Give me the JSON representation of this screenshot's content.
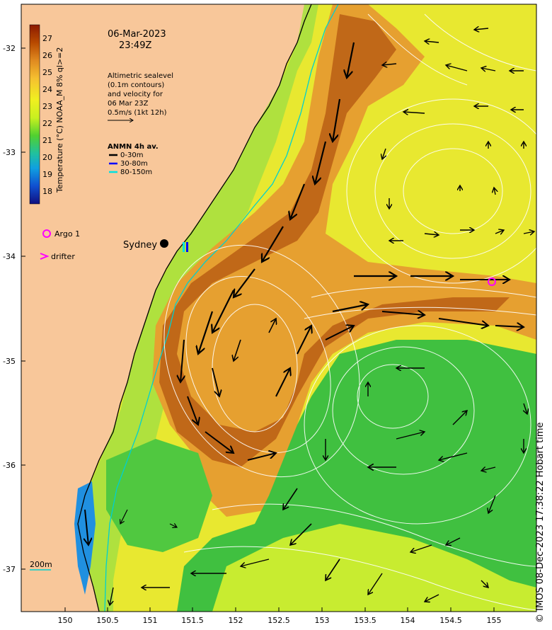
{
  "map": {
    "date": "06-Mar-2023",
    "time": "23:49Z",
    "info_lines": [
      "Altimetric sealevel",
      "(0.1m contours)",
      "and velocity for",
      "06 Mar 23Z",
      "0.5m/s (1kt 12h)"
    ],
    "colorbar": {
      "label": "Temperature (°C) NOAA_M 8% ql>=2",
      "ticks": [
        "27",
        "26",
        "25",
        "24",
        "23",
        "22",
        "21",
        "20",
        "19",
        "18"
      ],
      "colors": [
        "#8b1a00",
        "#b84a00",
        "#e08a20",
        "#f5c030",
        "#f0f020",
        "#c8f020",
        "#50d030",
        "#20c0a0",
        "#10a0e0",
        "#1050d0",
        "#101080"
      ]
    },
    "anmn": {
      "title": "ANMN 4h av.",
      "items": [
        {
          "label": "0-30m",
          "color": "#000000"
        },
        {
          "label": "30-80m",
          "color": "#0000ff"
        },
        {
          "label": "80-150m",
          "color": "#00e0e0"
        }
      ]
    },
    "legend": {
      "argo": "Argo 1",
      "drifter": "drifter"
    },
    "city": "Sydney",
    "isobath": "200m",
    "lat_ticks": [
      "-32",
      "-33",
      "-34",
      "-35",
      "-36",
      "-37"
    ],
    "lon_ticks": [
      "150",
      "150.5",
      "151",
      "151.5",
      "152",
      "152.5",
      "153",
      "153.5",
      "154",
      "154.5",
      "155"
    ],
    "credit": "© IMOS 08-Dec-2023 17:38:22 Hobart time",
    "colors": {
      "land": "#f8c79a",
      "warm_core": "#b85a10",
      "cool_eddy": "#40c040",
      "arrow": "#000000",
      "contour": "#ffffff",
      "argo": "#ff00ff",
      "isobath": "#00d0d0"
    }
  }
}
